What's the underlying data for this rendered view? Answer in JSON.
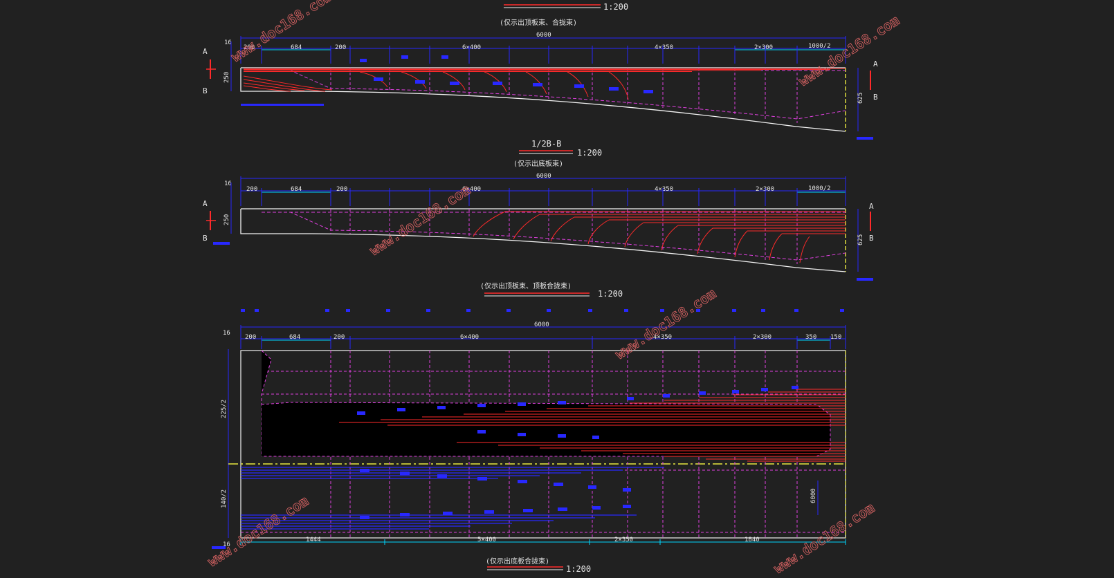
{
  "colors": {
    "background": "#212121",
    "dimension": "#2828ff",
    "cyan": "#00d7ff",
    "magenta": "#e040e0",
    "tendon": "#ff2a2a",
    "outline": "#f2f2f2",
    "yellow": "#e8e840",
    "text": "#e6e6e6",
    "watermark": "#d06060"
  },
  "watermark": "www.doc168.com",
  "view1": {
    "scale": "1:200",
    "caption": "(仅示出顶板束、合拢束)",
    "total": "6000",
    "top_dims": [
      "200",
      "684",
      "200",
      "6×400",
      "4×350",
      "2×300",
      "1000/2"
    ],
    "left_top": "16",
    "left_dim": "250",
    "right_dim": "625",
    "section_top": "A",
    "section_bottom": "B"
  },
  "view2": {
    "title": "1/2B-B",
    "scale": "1:200",
    "caption": "(仅示出底板束)",
    "total": "6000",
    "top_dims": [
      "200",
      "684",
      "200",
      "6×400",
      "4×350",
      "2×300",
      "1000/2"
    ],
    "left_top": "16",
    "left_dim": "250",
    "right_dim": "625",
    "section_top": "A",
    "section_bottom": "B"
  },
  "view3": {
    "pre_caption": "(仅示出顶板束、顶板合拢束)",
    "pre_scale": "1:200",
    "total": "6000",
    "top_dims": [
      "200",
      "684",
      "200",
      "6×400",
      "4×350",
      "2×300",
      "350",
      "150"
    ],
    "left_top": "16",
    "left_upper": "225/2",
    "left_lower": "140/2",
    "left_bottom": "16",
    "right_dim": "6000",
    "bottom_dims": [
      "1444",
      "5×400",
      "2×350",
      "1840"
    ],
    "caption": "(仅示出底板合拢束)",
    "scale": "1:200"
  }
}
